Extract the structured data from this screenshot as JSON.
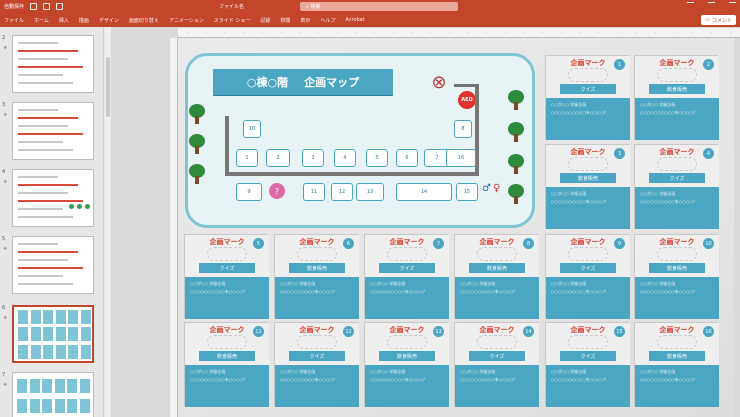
{
  "titlebar": {
    "autosave": "自動保存",
    "filename": "ファイル名",
    "search": "検索"
  },
  "ribbon": {
    "tabs": [
      "ファイル",
      "ホーム",
      "挿入",
      "描画",
      "デザイン",
      "画面切り替え",
      "アニメーション",
      "スライド ショー",
      "記録",
      "校閲",
      "表示",
      "ヘルプ",
      "Acrobat"
    ],
    "comment_label": "コメント"
  },
  "thumbnails": [
    {
      "num": "2",
      "star": "★"
    },
    {
      "num": "3",
      "star": "★"
    },
    {
      "num": "4",
      "star": "★"
    },
    {
      "num": "5",
      "star": "★"
    },
    {
      "num": "6",
      "star": "★"
    },
    {
      "num": "7",
      "star": "★"
    }
  ],
  "map": {
    "title_left": "○棟○階",
    "title_right": "企画マップ",
    "aed": "AED",
    "question": "?",
    "rooms": [
      "10",
      "1",
      "2",
      "3",
      "4",
      "5",
      "6",
      "7",
      "8",
      "9",
      "11",
      "12",
      "13",
      "14",
      "15",
      "16"
    ]
  },
  "cards": [
    {
      "num": "1",
      "title": "企画マーク",
      "label": "クイズ",
      "line1": "○○が○○ 学級企画",
      "line2": "○○○○○○○○○○を○○○○？"
    },
    {
      "num": "2",
      "title": "企画マーク",
      "label": "飲食販売",
      "line1": "○○が○○ 学級企画",
      "line2": "○○○○○○○○○○を○○○○？"
    },
    {
      "num": "3",
      "title": "企画マーク",
      "label": "飲食販売",
      "line1": "○○が○○ 学級企画",
      "line2": "○○○○○○○○○○を○○○○？"
    },
    {
      "num": "4",
      "title": "企画マーク",
      "label": "クイズ",
      "line1": "○○が○○ 学級企画",
      "line2": "○○○○○○○○○○を○○○○？"
    },
    {
      "num": "5",
      "title": "企画マーク",
      "label": "クイズ",
      "line1": "○○が○○ 学級企画",
      "line2": "○○○○○○○○○○を○○○○？"
    },
    {
      "num": "6",
      "title": "企画マーク",
      "label": "飲食販売",
      "line1": "○○が○○ 学級企画",
      "line2": "○○○○○○○○○○を○○○○？"
    },
    {
      "num": "7",
      "title": "企画マーク",
      "label": "クイズ",
      "line1": "○○が○○ 学級企画",
      "line2": "○○○○○○○○○○を○○○○？"
    },
    {
      "num": "8",
      "title": "企画マーク",
      "label": "飲食販売",
      "line1": "○○が○○ 学級企画",
      "line2": "○○○○○○○○○○を○○○○？"
    },
    {
      "num": "9",
      "title": "企画マーク",
      "label": "クイズ",
      "line1": "○○が○○ 学級企画",
      "line2": "○○○○○○○○○○を○○○○？"
    },
    {
      "num": "10",
      "title": "企画マーク",
      "label": "飲食販売",
      "line1": "○○が○○ 学級企画",
      "line2": "○○○○○○○○○○を○○○○？"
    },
    {
      "num": "11",
      "title": "企画マーク",
      "label": "飲食販売",
      "line1": "○○が○○ 学級企画",
      "line2": "○○○○○○○○○○を○○○○？"
    },
    {
      "num": "12",
      "title": "企画マーク",
      "label": "クイズ",
      "line1": "○○が○○ 学級企画",
      "line2": "○○○○○○○○○○を○○○○？"
    },
    {
      "num": "13",
      "title": "企画マーク",
      "label": "飲食販売",
      "line1": "○○が○○ 学級企画",
      "line2": "○○○○○○○○○○を○○○○？"
    },
    {
      "num": "14",
      "title": "企画マーク",
      "label": "クイズ",
      "line1": "○○が○○ 学級企画",
      "line2": "○○○○○○○○○○を○○○○？"
    },
    {
      "num": "15",
      "title": "企画マーク",
      "label": "クイズ",
      "line1": "○○が○○ 学級企画",
      "line2": "○○○○○○○○○○を○○○○？"
    },
    {
      "num": "16",
      "title": "企画マーク",
      "label": "飲食販売",
      "line1": "○○が○○ 学級企画",
      "line2": "○○○○○○○○○○を○○○○？"
    }
  ]
}
